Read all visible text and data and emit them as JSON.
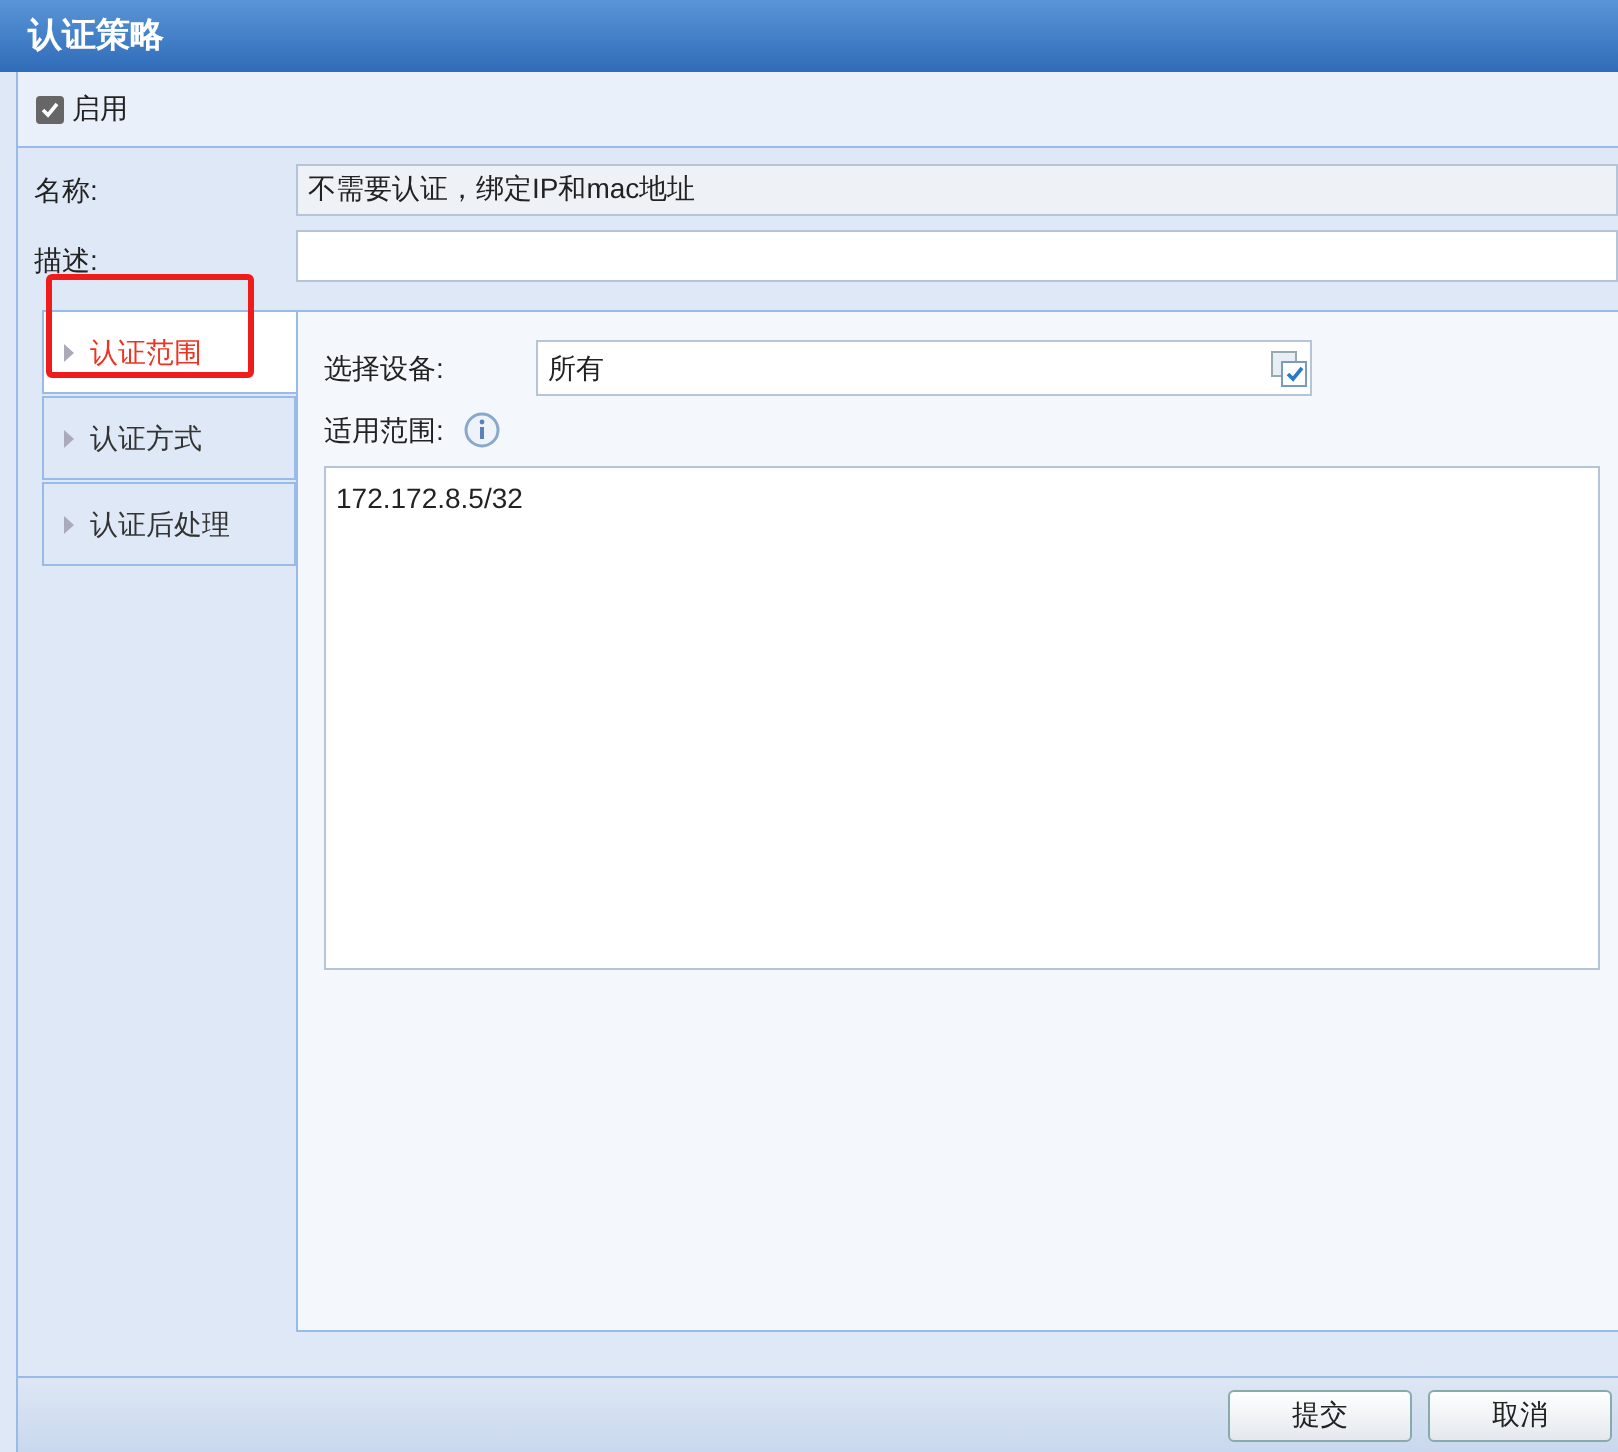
{
  "window": {
    "title": "认证策略"
  },
  "enable": {
    "label": "启用",
    "checked": true
  },
  "form": [
    {
      "label": "名称:",
      "value": "不需要认证，绑定IP和mac地址",
      "readonly": true
    },
    {
      "label": "描述:",
      "readonly": false
    }
  ],
  "nav": [
    {
      "label": "认证范围",
      "selected": true
    },
    {
      "label": "认证方式",
      "selected": false
    },
    {
      "label": "认证后处理",
      "selected": false
    }
  ],
  "device": {
    "label": "选择设备:",
    "value": "所有"
  },
  "scope": {
    "label": "适用范围:",
    "value": "172.172.8.5/32"
  },
  "buttons": [
    "提交",
    "取消"
  ]
}
